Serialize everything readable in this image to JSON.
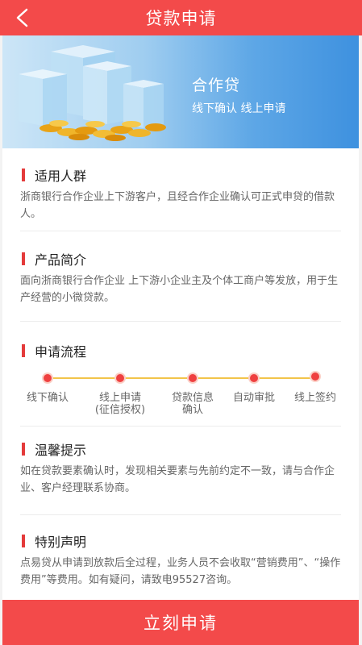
{
  "header": {
    "title": "贷款申请",
    "back_icon": "back-arrow-icon"
  },
  "banner": {
    "title": "合作贷",
    "subtitle": "线下确认  线上申请"
  },
  "sections": [
    {
      "title": "适用人群",
      "text": "浙商银行合作企业上下游客户，且经合作企业确认可正式申贷的借款人。"
    },
    {
      "title": "产品简介",
      "text": "面向浙商银行合作企业 上下游小企业主及个体工商户等发放，用于生产经营的小微贷款。"
    },
    {
      "title": "申请流程"
    },
    {
      "title": "温馨提示",
      "text": "如在贷款要素确认时，发现相关要素与先前约定不一致，请与合作企业、客户经理联系协商。"
    },
    {
      "title": "特别声明",
      "text": "点易贷从申请到放款后全过程，业务人员不会收取“营销费用”、“操作费用”等费用。如有疑问，请致电95527咨询。"
    }
  ],
  "flow_steps": [
    {
      "label": "线下确认"
    },
    {
      "label": "线上申请\n(征信授权)"
    },
    {
      "label": "贷款信息\n确认"
    },
    {
      "label": "自动审批"
    },
    {
      "label": "线上签约"
    }
  ],
  "footer": {
    "apply_label": "立刻申请"
  },
  "colors": {
    "primary": "#f34a4a",
    "accent_bar": "#e43b3b",
    "flow_line": "#f2c44a",
    "banner_blue": "#3e91df"
  }
}
